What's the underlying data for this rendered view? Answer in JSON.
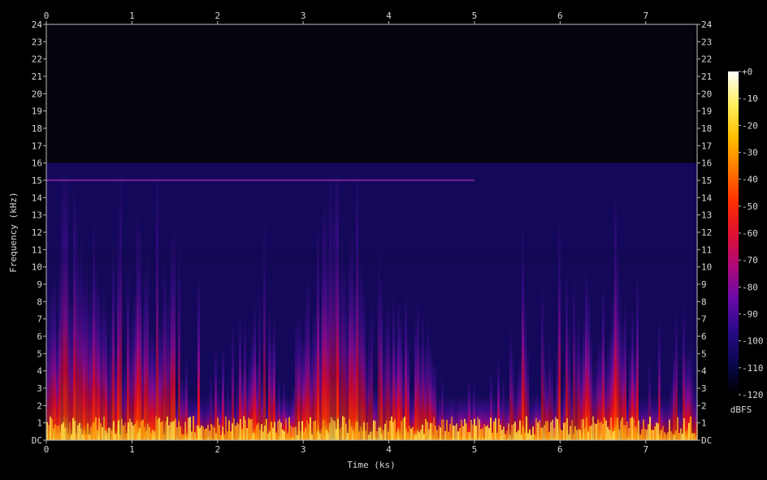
{
  "chart_data": {
    "type": "heatmap",
    "subtype": "spectrogram",
    "xlabel": "Time (ks)",
    "ylabel": "Frequency (kHz)",
    "x_ticks": [
      "0",
      "1",
      "2",
      "3",
      "4",
      "5",
      "6",
      "7"
    ],
    "x_range": [
      0,
      7.6
    ],
    "y_ticks": [
      "DC",
      "1",
      "2",
      "3",
      "4",
      "5",
      "6",
      "7",
      "8",
      "9",
      "10",
      "11",
      "12",
      "13",
      "14",
      "15",
      "16",
      "17",
      "18",
      "19",
      "20",
      "21",
      "22",
      "23",
      "24"
    ],
    "y_range": [
      0,
      24
    ],
    "frequency_cutoff_khz": 16,
    "persistent_tone_khz": 15,
    "colorbar": {
      "label": "dBFS",
      "ticks": [
        "+0",
        "-10",
        "-20",
        "-30",
        "-40",
        "-50",
        "-60",
        "-70",
        "-80",
        "-90",
        "-100",
        "-110",
        "-120"
      ],
      "range": [
        -120,
        0
      ],
      "colormap": [
        "#000000",
        "#0a0850",
        "#2a0a8a",
        "#6a0aa8",
        "#b00878",
        "#e01030",
        "#ff3000",
        "#ff7a00",
        "#ffc000",
        "#fff060",
        "#ffffff"
      ]
    },
    "grid": false,
    "background_color": "#000000",
    "axis_color": "#bbbbbb",
    "text_color": "#d8d8d8"
  }
}
